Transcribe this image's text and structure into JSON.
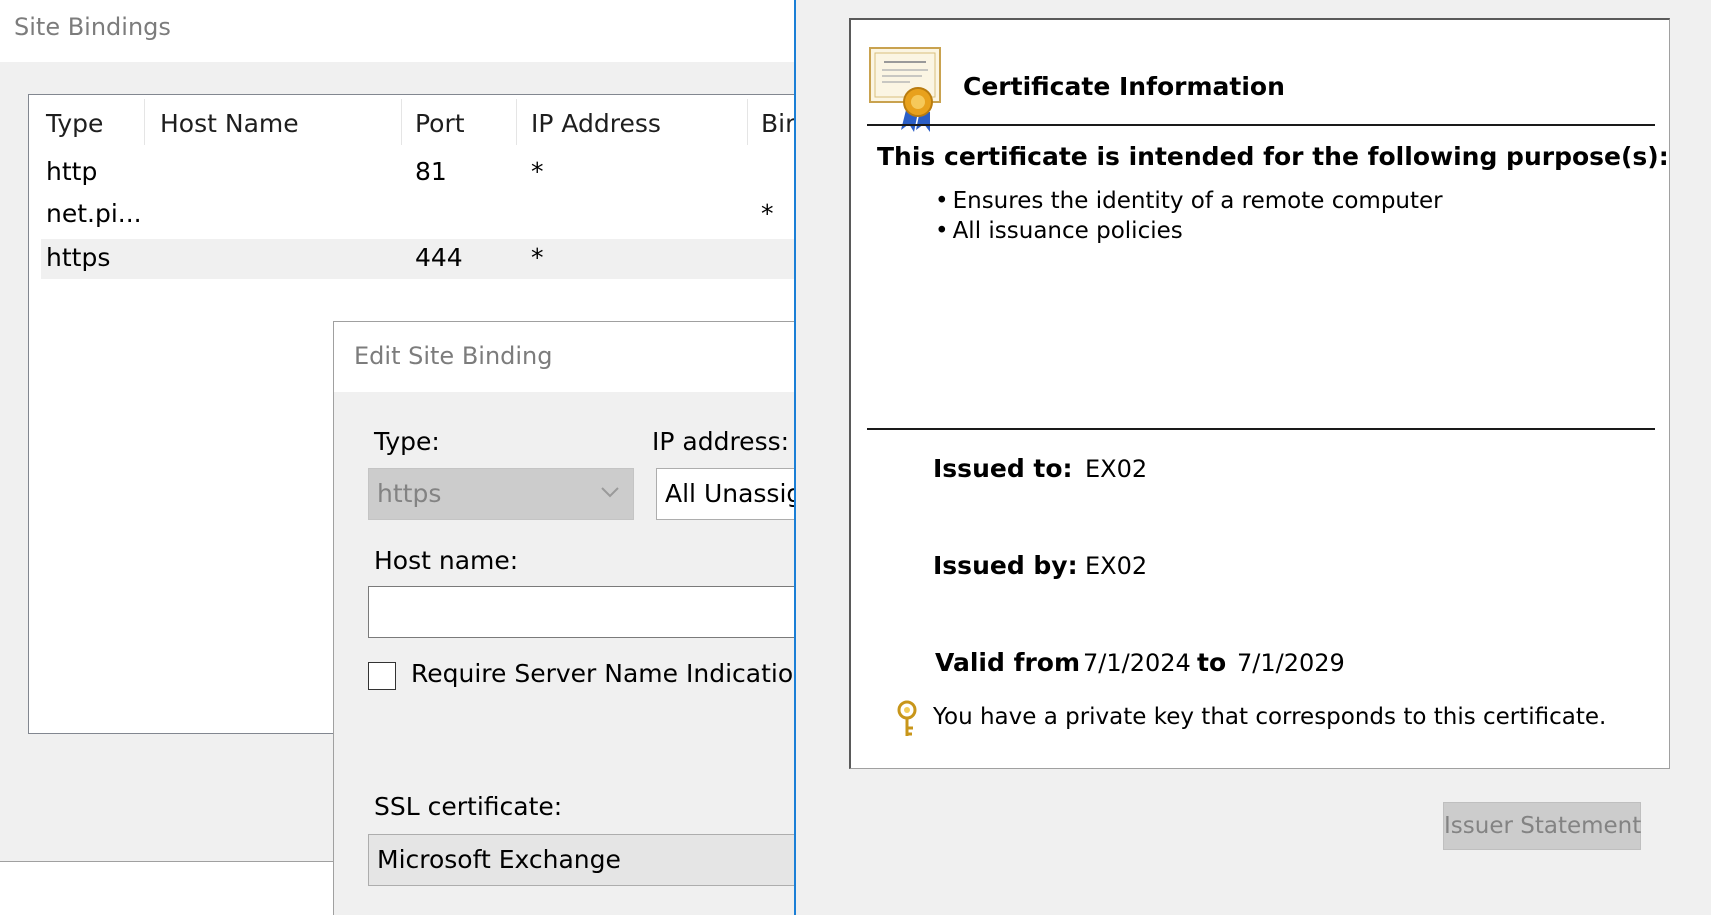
{
  "site_bindings": {
    "title": "Site Bindings",
    "columns": [
      "Type",
      "Host Name",
      "Port",
      "IP Address",
      "Bir"
    ],
    "rows": [
      {
        "type": "http",
        "host": "",
        "port": "81",
        "ip": "*",
        "binding": ""
      },
      {
        "type": "net.pi...",
        "host": "",
        "port": "",
        "ip": "",
        "binding": "*"
      },
      {
        "type": "https",
        "host": "",
        "port": "444",
        "ip": "*",
        "binding": ""
      }
    ]
  },
  "edit_binding": {
    "title": "Edit Site Binding",
    "type_label": "Type:",
    "type_value": "https",
    "ip_label": "IP address:",
    "ip_value": "All Unassig",
    "host_label": "Host name:",
    "host_value": "",
    "sni_label": "Require Server Name Indication",
    "sni_checked": false,
    "ssl_label": "SSL certificate:",
    "ssl_value": "Microsoft Exchange"
  },
  "certificate": {
    "heading": "Certificate Information",
    "purpose_heading": "This certificate is intended for the following purpose(s):",
    "purposes": [
      "Ensures the identity of a remote computer",
      "All issuance policies"
    ],
    "issued_to_label": "Issued to:",
    "issued_to": "EX02",
    "issued_by_label": "Issued by:",
    "issued_by": "EX02",
    "valid_from_label": "Valid from",
    "valid_from": "7/1/2024",
    "to_label": "to",
    "valid_to": "7/1/2029",
    "private_key_note": "You have a private key that corresponds to this certificate.",
    "issuer_statement_label": "Issuer Statement"
  },
  "colors": {
    "window_background": "#f0f0f0",
    "accent_border": "#1b7fd6",
    "disabled_text": "#838383"
  },
  "icons": [
    "certificate-icon",
    "chevron-down-icon",
    "key-icon"
  ]
}
